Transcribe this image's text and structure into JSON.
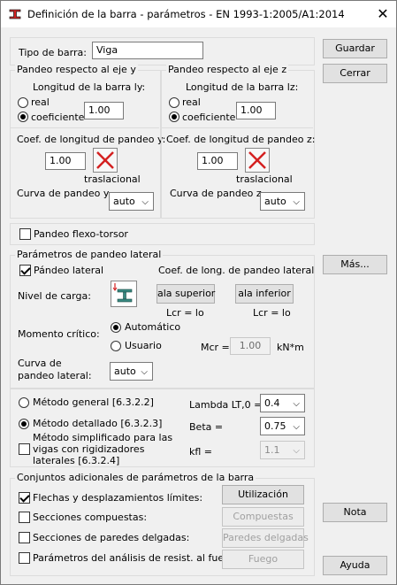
{
  "window": {
    "title": "Definición de la barra - parámetros - EN 1993-1:2005/A1:2014"
  },
  "bar_type": {
    "label": "Tipo de barra:",
    "value": "Viga"
  },
  "buttons": {
    "guardar": "Guardar",
    "cerrar": "Cerrar",
    "mas": "Más...",
    "nota": "Nota",
    "ayuda": "Ayuda"
  },
  "pandeo_y": {
    "title": "Pandeo respecto al eje y",
    "length_label": "Longitud de la barra ly:",
    "real": "real",
    "coef": "coeficiente",
    "length_value": "1.00",
    "coef_label": "Coef. de longitud de pandeo y:",
    "coef_value": "1.00",
    "traslacional": "traslacional",
    "curve_label": "Curva de pandeo y",
    "curve_value": "auto"
  },
  "pandeo_z": {
    "title": "Pandeo respecto al eje z",
    "length_label": "Longitud de la barra lz:",
    "real": "real",
    "coef": "coeficiente",
    "length_value": "1.00",
    "coef_label": "Coef. de longitud de pandeo  z:",
    "coef_value": "1.00",
    "traslacional": "traslacional",
    "curve_label": "Curva de pandeo z",
    "curve_value": "auto"
  },
  "flexo_torsor": {
    "label": "Pandeo flexo-torsor",
    "checked": false
  },
  "lateral": {
    "title": "Parámetros de pandeo lateral",
    "check_label": "Pándeo lateral",
    "coef_title": "Coef. de long. de pandeo lateral",
    "load_level": "Nivel de carga:",
    "btn_superior": "ala superior",
    "btn_inferior": "ala inferior",
    "lcr1": "Lcr =  lo",
    "lcr2": "Lcr =  lo",
    "moment_label": "Momento crítico:",
    "auto": "Automático",
    "usuario": "Usuario",
    "mcr_label": "Mcr =",
    "mcr_value": "1.00",
    "mcr_unit": "kN*m",
    "curve_label": "Curva de pandeo lateral:",
    "curve_value": "auto"
  },
  "methods": {
    "general": "Método general [6.3.2.2]",
    "detallado": "Método detallado [6.3.2.3]",
    "simplificado": "Método simplificado para las vigas con rigidizadores laterales [6.3.2.4]",
    "lambda_label": "Lambda LT,0 =",
    "lambda_value": "0.4",
    "beta_label": "Beta =",
    "beta_value": "0.75",
    "kfl_label": "kfl =",
    "kfl_value": "1.1"
  },
  "additional": {
    "title": "Conjuntos adicionales de parámetros de la barra",
    "flechas": "Flechas y desplazamientos límites:",
    "compuestas": "Secciones compuestas:",
    "paredes": "Secciones de paredes delgadas:",
    "fuego": "Parámetros del análisis de resist. al fuego:",
    "btn_utilizacion": "Utilización",
    "btn_compuestas": "Compuestas",
    "btn_paredes": "Paredes delgadas",
    "btn_fuego": "Fuego"
  },
  "colors": {
    "red_cross": "#d42020",
    "app_icon": "#d42020"
  }
}
